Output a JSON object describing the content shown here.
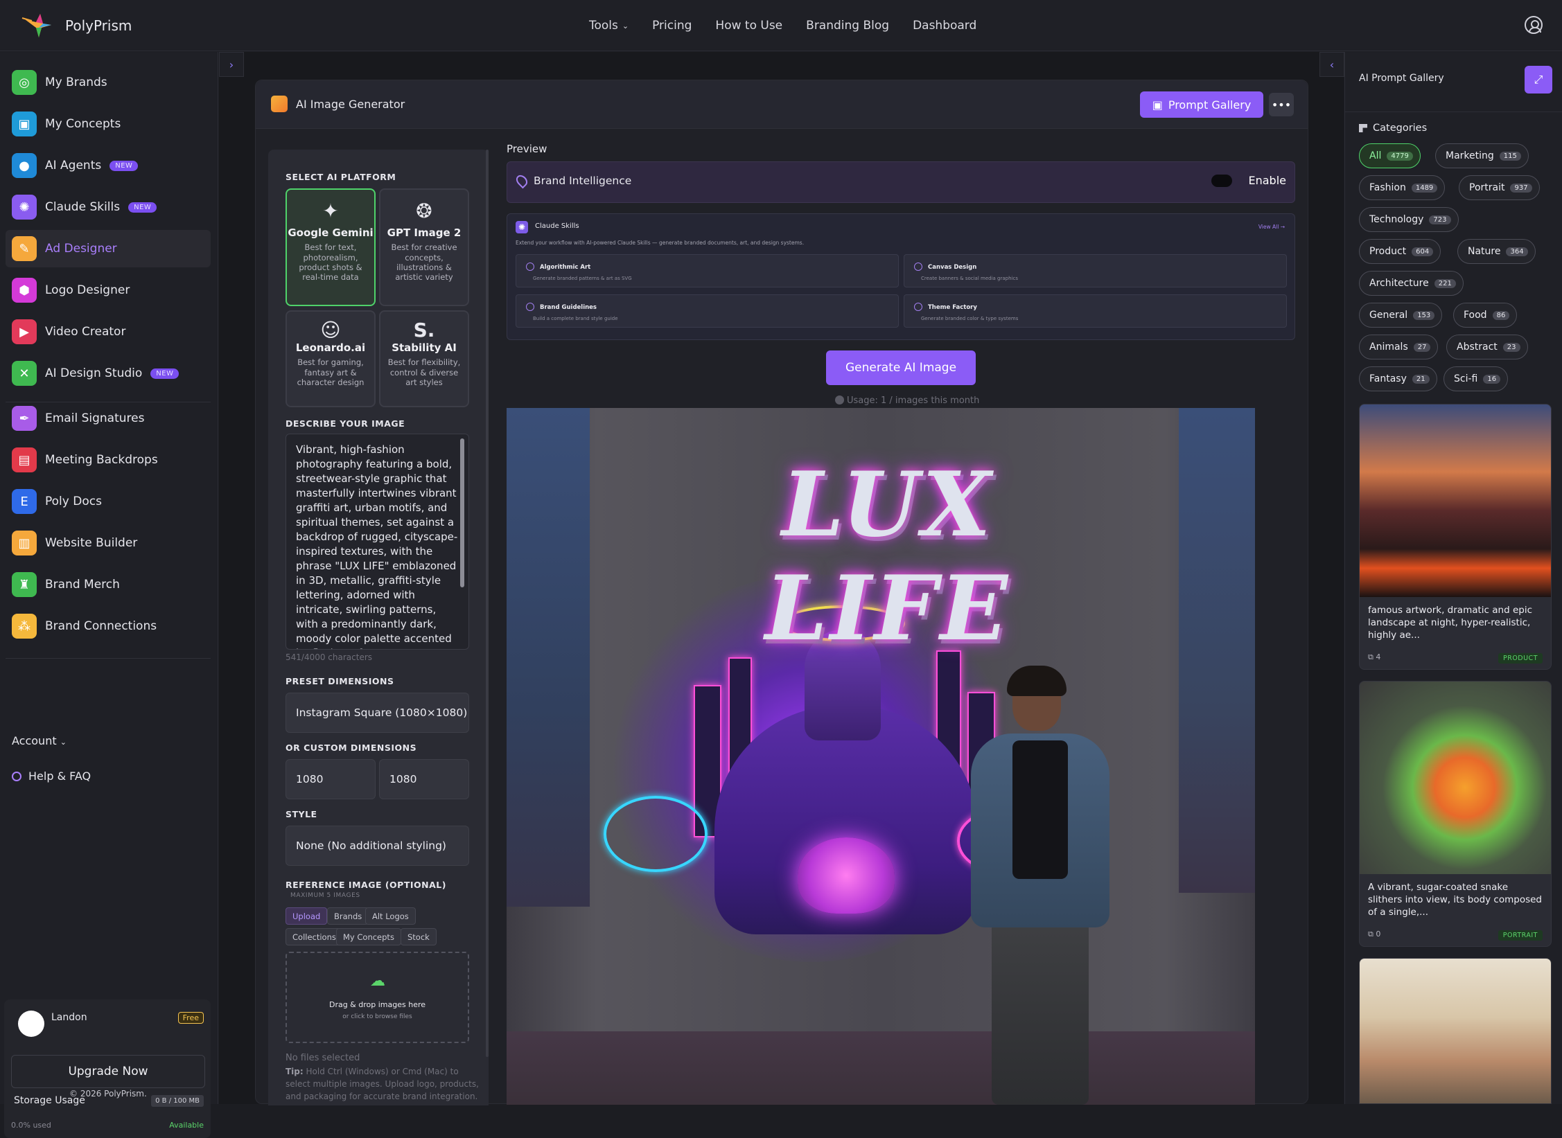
{
  "app": {
    "name": "PolyPrism"
  },
  "topnav": {
    "tools": "Tools",
    "pricing": "Pricing",
    "how_to_use": "How to Use",
    "branding_blog": "Branding Blog",
    "dashboard": "Dashboard"
  },
  "sidebar": {
    "items": [
      {
        "label": "My Brands",
        "color": "#3fb950"
      },
      {
        "label": "My Concepts",
        "color": "#1f9bd8"
      },
      {
        "label": "AI Agents",
        "badge": "NEW",
        "color": "#1f8ad8"
      },
      {
        "label": "Claude Skills",
        "badge": "NEW",
        "color": "#8a5cf0"
      },
      {
        "label": "Ad Designer",
        "color": "#f5a83c"
      },
      {
        "label": "Logo Designer",
        "color": "#d43ad8"
      },
      {
        "label": "Video Creator",
        "color": "#e23a5a"
      },
      {
        "label": "AI Design Studio",
        "badge": "NEW",
        "color": "#3fb950"
      },
      {
        "label": "Email Signatures",
        "color": "#a85ce8"
      },
      {
        "label": "Meeting Backdrops",
        "color": "#e23a4a"
      },
      {
        "label": "Poly Docs",
        "color": "#2f6ae8"
      },
      {
        "label": "Website Builder",
        "color": "#f5a83c"
      },
      {
        "label": "Brand Merch",
        "color": "#3fb950"
      },
      {
        "label": "Brand Connections",
        "color": "#f5b83c"
      }
    ],
    "account": "Account",
    "help": "Help & FAQ",
    "user": {
      "name": "Landon",
      "plan": "Free"
    },
    "upgrade": "Upgrade Now",
    "storage_label": "Storage Usage",
    "storage_value": "0 B / 100 MB",
    "storage_used": "0.0% used",
    "storage_status": "Available",
    "copyright": "© 2026 PolyPrism."
  },
  "generator": {
    "title": "AI Image Generator",
    "prompt_gallery": "Prompt Gallery",
    "more": "•••",
    "select_platform": "SELECT AI PLATFORM",
    "platforms": [
      {
        "name": "Google Gemini",
        "desc": "Best for text, photorealism, product shots & real-time data",
        "selected": true
      },
      {
        "name": "GPT Image 2",
        "desc": "Best for creative concepts, illustrations & artistic variety"
      },
      {
        "name": "Leonardo.ai",
        "desc": "Best for gaming, fantasy art & character design"
      },
      {
        "name": "Stability AI",
        "desc": "Best for flexibility, control & diverse art styles"
      }
    ],
    "describe_label": "DESCRIBE YOUR IMAGE",
    "prompt": "Vibrant, high-fashion photography featuring a bold, streetwear-style graphic that masterfully intertwines vibrant graffiti art, urban motifs, and spiritual themes, set against a backdrop of rugged, cityscape-inspired textures, with the phrase \"LUX LIFE\" emblazoned in 3D, metallic, graffiti-style lettering, adorned with intricate, swirling patterns, with a predominantly dark, moody color palette accented by flashes of",
    "char_count": "541/4000 characters",
    "preset_label": "PRESET DIMENSIONS",
    "preset_value": "Instagram Square (1080×1080)",
    "custom_label": "OR CUSTOM DIMENSIONS",
    "width": "1080",
    "height": "1080",
    "style_label": "STYLE",
    "style_value": "None (No additional styling)",
    "reference_label": "REFERENCE IMAGE (OPTIONAL)",
    "reference_sub": "MAXIMUM 5 IMAGES",
    "ref_tabs": [
      "Upload",
      "Brands",
      "Alt Logos",
      "Collections",
      "My Concepts",
      "Stock"
    ],
    "drop_title": "Drag & drop images here",
    "drop_sub": "or click to browse files",
    "no_files": "No files selected",
    "tip_bold": "Tip:",
    "tip": "Hold Ctrl (Windows) or Cmd (Mac) to select multiple images. Upload logo, products, and packaging for accurate brand integration."
  },
  "preview": {
    "label": "Preview",
    "brand_intel": "Brand Intelligence",
    "enable": "Enable",
    "claude_skills": "Claude Skills",
    "claude_sub": "Extend your workflow with AI-powered Claude Skills — generate branded documents, art, and design systems.",
    "view_all": "View All →",
    "skills": [
      {
        "name": "Algorithmic Art",
        "desc": "Generate branded patterns & art as SVG"
      },
      {
        "name": "Canvas Design",
        "desc": "Create banners & social media graphics"
      },
      {
        "name": "Brand Guidelines",
        "desc": "Build a complete brand style guide"
      },
      {
        "name": "Theme Factory",
        "desc": "Generate branded color & type systems"
      }
    ],
    "generate": "Generate AI Image",
    "usage": "Usage: 1 / images this month",
    "image_text": "LUX LIFE"
  },
  "gallery": {
    "title": "AI Prompt Gallery",
    "categories_label": "Categories",
    "categories": [
      {
        "name": "All",
        "count": "4779",
        "active": true
      },
      {
        "name": "Marketing",
        "count": "115"
      },
      {
        "name": "Fashion",
        "count": "1489"
      },
      {
        "name": "Portrait",
        "count": "937"
      },
      {
        "name": "Technology",
        "count": "723"
      },
      {
        "name": "Product",
        "count": "604"
      },
      {
        "name": "Nature",
        "count": "364"
      },
      {
        "name": "Architecture",
        "count": "221"
      },
      {
        "name": "General",
        "count": "153"
      },
      {
        "name": "Food",
        "count": "86"
      },
      {
        "name": "Animals",
        "count": "27"
      },
      {
        "name": "Abstract",
        "count": "23"
      },
      {
        "name": "Fantasy",
        "count": "21"
      },
      {
        "name": "Sci-fi",
        "count": "16"
      }
    ],
    "cards": [
      {
        "text": "famous artwork, dramatic and epic landscape at night, hyper-realistic, highly ae...",
        "copies": "4",
        "tag": "PRODUCT"
      },
      {
        "text": "A vibrant, sugar-coated snake slithers into view, its body composed of a single,...",
        "copies": "0",
        "tag": "PORTRAIT"
      }
    ]
  }
}
